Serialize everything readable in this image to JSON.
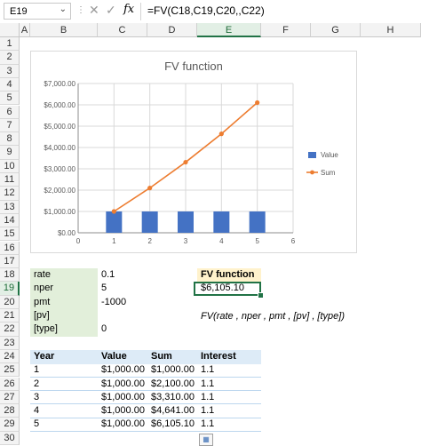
{
  "name_box": "E19",
  "formula": "=FV(C18,C19,C20,,C22)",
  "columns": [
    "A",
    "B",
    "C",
    "D",
    "E",
    "F",
    "G",
    "H"
  ],
  "rows": [
    "1",
    "2",
    "3",
    "4",
    "5",
    "6",
    "7",
    "8",
    "9",
    "10",
    "11",
    "12",
    "13",
    "14",
    "15",
    "16",
    "17",
    "18",
    "19",
    "20",
    "21",
    "22",
    "23",
    "24",
    "25",
    "26",
    "27",
    "28",
    "29",
    "30"
  ],
  "selected_column": "E",
  "selected_row": "19",
  "params": [
    {
      "label": "rate",
      "value": "0.1"
    },
    {
      "label": "nper",
      "value": "5"
    },
    {
      "label": "pmt",
      "value": "-1000"
    },
    {
      "label": "[pv]",
      "value": ""
    },
    {
      "label": "[type]",
      "value": "0"
    }
  ],
  "fv_header": "FV function",
  "fv_result": "$6,105.10",
  "syntax": "FV(rate , nper , pmt , [pv] , [type])",
  "table": {
    "headers": [
      "Year",
      "Value",
      "Sum",
      "Interest"
    ],
    "rows": [
      [
        "1",
        "$1,000.00",
        "$1,000.00",
        "1.1"
      ],
      [
        "2",
        "$1,000.00",
        "$2,100.00",
        "1.1"
      ],
      [
        "3",
        "$1,000.00",
        "$3,310.00",
        "1.1"
      ],
      [
        "4",
        "$1,000.00",
        "$4,641.00",
        "1.1"
      ],
      [
        "5",
        "$1,000.00",
        "$6,105.10",
        "1.1"
      ]
    ]
  },
  "colors": {
    "bar": "#4472c4",
    "line": "#ed7d31",
    "accent": "#217346"
  },
  "chart_data": {
    "type": "bar",
    "title": "FV function",
    "x": [
      1,
      2,
      3,
      4,
      5
    ],
    "xlim": [
      0,
      6
    ],
    "x_ticks": [
      "0",
      "1",
      "2",
      "3",
      "4",
      "5",
      "6"
    ],
    "ylim": [
      0,
      7000
    ],
    "y_ticks": [
      "$0.00",
      "$1,000.00",
      "$2,000.00",
      "$3,000.00",
      "$4,000.00",
      "$5,000.00",
      "$6,000.00",
      "$7,000.00"
    ],
    "grid": true,
    "legend_position": "right",
    "series": [
      {
        "name": "Value",
        "type": "bar",
        "values": [
          1000,
          1000,
          1000,
          1000,
          1000
        ]
      },
      {
        "name": "Sum",
        "type": "line",
        "values": [
          1000,
          2100,
          3310,
          4641,
          6105.1
        ]
      }
    ]
  }
}
